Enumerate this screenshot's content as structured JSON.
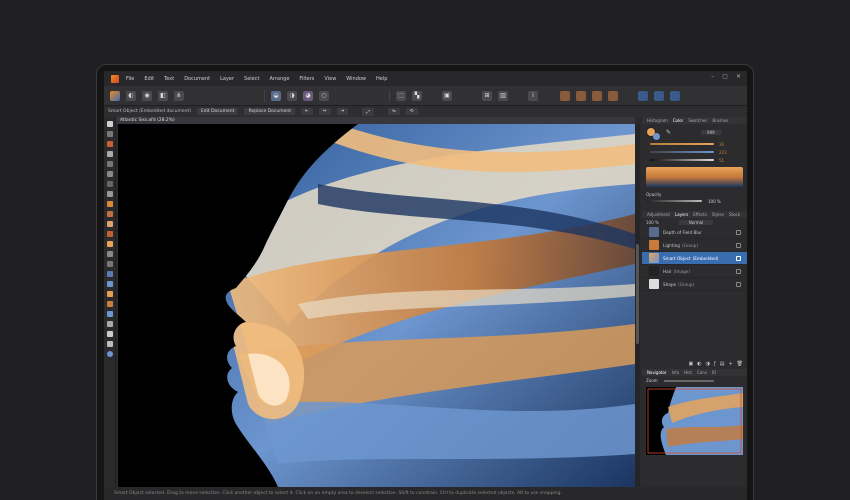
{
  "app": {
    "menu": [
      "File",
      "Edit",
      "Text",
      "Document",
      "Layer",
      "Select",
      "Arrange",
      "Filters",
      "View",
      "Window",
      "Help"
    ]
  },
  "context_bar": {
    "label": "Smart Object (Embedded document)",
    "edit_label": "Edit Document",
    "replace_label": "Replace Document"
  },
  "document": {
    "tab_title": "Atlantic Sea.afd (28.2%)"
  },
  "panels": {
    "top_tabs": [
      "Histogram",
      "Color",
      "Swatches",
      "Brushes"
    ],
    "hsl_values": [
      "36",
      "223",
      "51"
    ],
    "hex_value": "999",
    "opacity_label": "Opacity",
    "opacity_value": "100 %",
    "layer_tabs": [
      "Adjustment",
      "Layers",
      "Effects",
      "Styles",
      "Stock"
    ],
    "blend": {
      "opacity": "100 %",
      "mode": "Normal"
    },
    "layers": [
      {
        "name": "Depth of Field Blur"
      },
      {
        "name": "Lighting",
        "kind": "(Group)"
      },
      {
        "name": "Smart Object",
        "kind": "(Embedded)"
      },
      {
        "name": "Hair",
        "kind": "(Image)"
      },
      {
        "name": "Shape",
        "kind": "(Group)"
      }
    ],
    "nav_tabs": [
      "Navigator",
      "Info",
      "Hist",
      "Cons",
      "IO"
    ],
    "zoom_label": "Zoom"
  },
  "status": {
    "text": "Smart Object selected. Drag to move selection. Click another object to select it. Click on an empty area to deselect selection. Shift to constrain. Ctrl to duplicate selected objects. Alt to use snapping."
  },
  "colors": {
    "selection": "#3a6db0",
    "accent_orange": "#e8a35a",
    "hair_blue": "#6d96cf"
  }
}
